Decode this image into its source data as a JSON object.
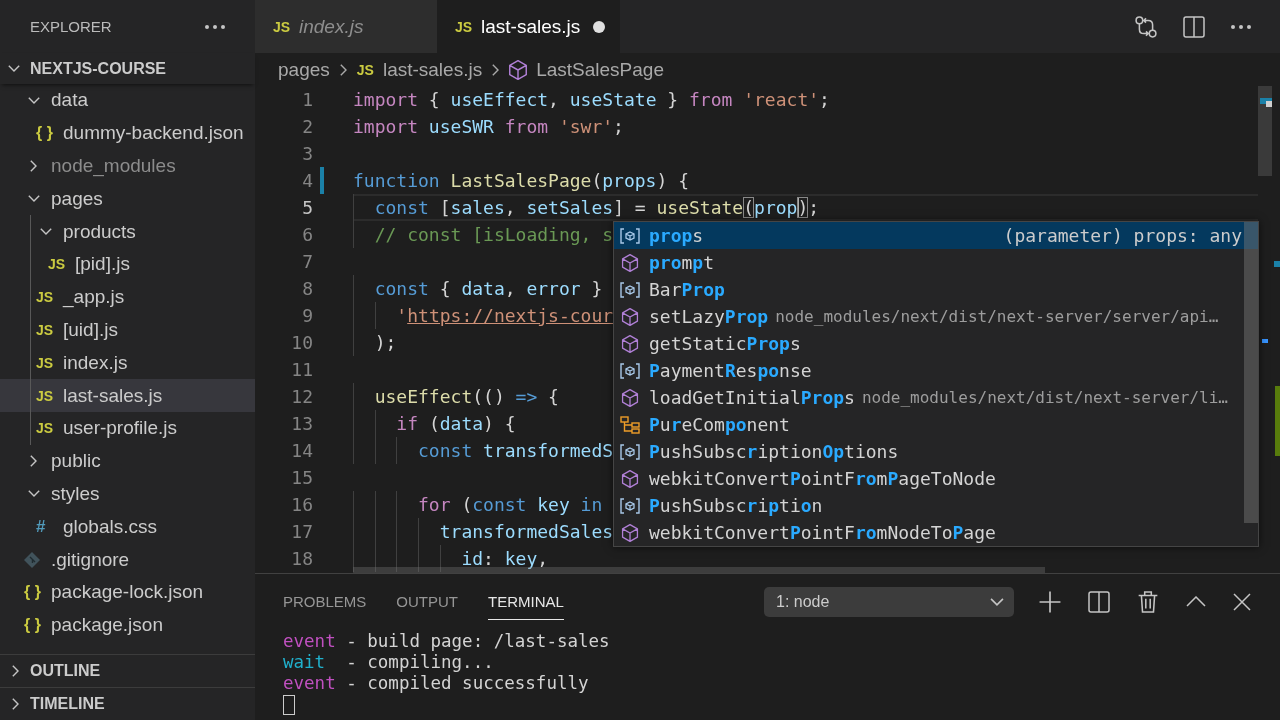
{
  "explorer": {
    "title": "EXPLORER",
    "root": {
      "label": "NEXTJS-COURSE",
      "expanded": true,
      "children": [
        {
          "kind": "folder",
          "label": "data",
          "expanded": true,
          "selected": false,
          "dimmed": false,
          "children": [
            {
              "kind": "json",
              "icon": "{ }",
              "label": "dummy-backend.json",
              "selected": false,
              "dimmed": false
            }
          ]
        },
        {
          "kind": "folder",
          "label": "node_modules",
          "expanded": false,
          "selected": false,
          "dimmed": true
        },
        {
          "kind": "folder",
          "label": "pages",
          "expanded": true,
          "selected": false,
          "dimmed": false,
          "children": [
            {
              "kind": "folder",
              "label": "products",
              "expanded": true,
              "selected": false,
              "dimmed": false,
              "children": [
                {
                  "kind": "js",
                  "icon": "JS",
                  "label": "[pid].js",
                  "selected": false,
                  "dimmed": false
                }
              ]
            },
            {
              "kind": "js",
              "icon": "JS",
              "label": "_app.js",
              "selected": false,
              "dimmed": false
            },
            {
              "kind": "js",
              "icon": "JS",
              "label": "[uid].js",
              "selected": false,
              "dimmed": false
            },
            {
              "kind": "js",
              "icon": "JS",
              "label": "index.js",
              "selected": false,
              "dimmed": false
            },
            {
              "kind": "js",
              "icon": "JS",
              "label": "last-sales.js",
              "selected": true,
              "dimmed": false
            },
            {
              "kind": "js",
              "icon": "JS",
              "label": "user-profile.js",
              "selected": false,
              "dimmed": false
            }
          ]
        },
        {
          "kind": "folder",
          "label": "public",
          "expanded": false,
          "selected": false,
          "dimmed": false
        },
        {
          "kind": "folder",
          "label": "styles",
          "expanded": true,
          "selected": false,
          "dimmed": false,
          "children": [
            {
              "kind": "css",
              "icon": "#",
              "label": "globals.css",
              "selected": false,
              "dimmed": false
            }
          ]
        },
        {
          "kind": "git",
          "label": ".gitignore",
          "selected": false,
          "dimmed": false
        },
        {
          "kind": "json",
          "icon": "{ }",
          "label": "package-lock.json",
          "selected": false,
          "dimmed": false
        },
        {
          "kind": "json",
          "icon": "{ }",
          "label": "package.json",
          "selected": false,
          "dimmed": false
        }
      ]
    },
    "sections": [
      {
        "label": "OUTLINE",
        "expanded": false
      },
      {
        "label": "TIMELINE",
        "expanded": false
      }
    ]
  },
  "tabs": [
    {
      "icon": "JS",
      "label": "index.js",
      "selected": false,
      "preview": true,
      "dirty": false
    },
    {
      "icon": "JS",
      "label": "last-sales.js",
      "selected": true,
      "preview": false,
      "dirty": true
    }
  ],
  "breadcrumbs": [
    {
      "kind": "folder",
      "label": "pages"
    },
    {
      "kind": "file",
      "icon": "JS",
      "label": "last-sales.js"
    },
    {
      "kind": "symbol",
      "label": "LastSalesPage"
    }
  ],
  "editor": {
    "lines": [
      {
        "number": "1",
        "current": false,
        "modified": false,
        "tokens": [
          {
            "kind": "kw",
            "text": "import"
          },
          {
            "kind": "p",
            "text": " { "
          },
          {
            "kind": "var",
            "text": "useEffect"
          },
          {
            "kind": "p",
            "text": ", "
          },
          {
            "kind": "var",
            "text": "useState"
          },
          {
            "kind": "p",
            "text": " } "
          },
          {
            "kind": "kw",
            "text": "from"
          },
          {
            "kind": "str",
            "text": " 'react'"
          },
          {
            "kind": "p",
            "text": ";"
          }
        ]
      },
      {
        "number": "2",
        "current": false,
        "modified": false,
        "tokens": [
          {
            "kind": "kw",
            "text": "import"
          },
          {
            "kind": "var",
            "text": " useSWR"
          },
          {
            "kind": "kw",
            "text": " from"
          },
          {
            "kind": "str",
            "text": " 'swr'"
          },
          {
            "kind": "p",
            "text": ";"
          }
        ]
      },
      {
        "number": "3",
        "current": false,
        "modified": false
      },
      {
        "number": "4",
        "current": false,
        "modified": true,
        "tokens": [
          {
            "kind": "st",
            "text": "function"
          },
          {
            "kind": "fn",
            "text": " LastSalesPage"
          },
          {
            "kind": "p",
            "text": "("
          },
          {
            "kind": "var",
            "text": "props"
          },
          {
            "kind": "p",
            "text": ") {"
          }
        ]
      },
      {
        "number": "5",
        "current": true,
        "modified": false,
        "tokens": [
          {
            "kind": "st",
            "text": "  const"
          },
          {
            "kind": "p",
            "text": " ["
          },
          {
            "kind": "var",
            "text": "sales"
          },
          {
            "kind": "p",
            "text": ", "
          },
          {
            "kind": "var",
            "text": "setSales"
          },
          {
            "kind": "p",
            "text": "] = "
          },
          {
            "kind": "fn",
            "text": "useState"
          },
          {
            "kind": "bm",
            "text": "("
          },
          {
            "kind": "typed",
            "text": "prop"
          },
          {
            "kind": "bm",
            "text": ")"
          },
          {
            "kind": "p",
            "text": ";"
          }
        ]
      },
      {
        "number": "6",
        "current": false,
        "modified": false,
        "tokens": [
          {
            "kind": "cm",
            "text": "  // const [isLoading, s"
          }
        ]
      },
      {
        "number": "7",
        "current": false,
        "modified": false
      },
      {
        "number": "8",
        "current": false,
        "modified": false,
        "tokens": [
          {
            "kind": "st",
            "text": "  const"
          },
          {
            "kind": "p",
            "text": " { "
          },
          {
            "kind": "var",
            "text": "data"
          },
          {
            "kind": "p",
            "text": ", "
          },
          {
            "kind": "var",
            "text": "error"
          },
          {
            "kind": "p",
            "text": " }"
          }
        ]
      },
      {
        "number": "9",
        "current": false,
        "modified": false,
        "tokens": [
          {
            "kind": "str",
            "text": "    '"
          },
          {
            "kind": "link",
            "text": "https://nextjs-cour"
          }
        ]
      },
      {
        "number": "10",
        "current": false,
        "modified": false,
        "tokens": [
          {
            "kind": "p",
            "text": "  );"
          }
        ]
      },
      {
        "number": "11",
        "current": false,
        "modified": false
      },
      {
        "number": "12",
        "current": false,
        "modified": false,
        "tokens": [
          {
            "kind": "fn",
            "text": "  useEffect"
          },
          {
            "kind": "p",
            "text": "(() "
          },
          {
            "kind": "st",
            "text": "=>"
          },
          {
            "kind": "p",
            "text": " {"
          }
        ]
      },
      {
        "number": "13",
        "current": false,
        "modified": false,
        "tokens": [
          {
            "kind": "kw",
            "text": "    if"
          },
          {
            "kind": "p",
            "text": " ("
          },
          {
            "kind": "var",
            "text": "data"
          },
          {
            "kind": "p",
            "text": ") {"
          }
        ]
      },
      {
        "number": "14",
        "current": false,
        "modified": false,
        "tokens": [
          {
            "kind": "st",
            "text": "      const"
          },
          {
            "kind": "var",
            "text": " transformedS"
          }
        ]
      },
      {
        "number": "15",
        "current": false,
        "modified": false
      },
      {
        "number": "16",
        "current": false,
        "modified": false,
        "tokens": [
          {
            "kind": "kw",
            "text": "      for"
          },
          {
            "kind": "p",
            "text": " ("
          },
          {
            "kind": "st",
            "text": "const"
          },
          {
            "kind": "var",
            "text": " key"
          },
          {
            "kind": "st",
            "text": " in"
          }
        ]
      },
      {
        "number": "17",
        "current": false,
        "modified": false,
        "tokens": [
          {
            "kind": "var",
            "text": "        transformedSales"
          }
        ]
      },
      {
        "number": "18",
        "current": false,
        "modified": false,
        "tokens": [
          {
            "kind": "var",
            "text": "          id"
          },
          {
            "kind": "p",
            "text": ": "
          },
          {
            "kind": "var",
            "text": "key"
          },
          {
            "kind": "p",
            "text": ","
          }
        ]
      }
    ],
    "suggestions": [
      {
        "kind": "variable",
        "label": "**prop**s",
        "detail": "(parameter) props: any",
        "selected": true
      },
      {
        "kind": "method",
        "label": "**pro**m**p**t",
        "selected": false
      },
      {
        "kind": "variable",
        "label": "Bar**Prop**",
        "selected": false
      },
      {
        "kind": "method",
        "label": "setLazy**Prop**",
        "detail": "node_modules/next/dist/next-server/server/api…",
        "selected": false
      },
      {
        "kind": "method",
        "label": "getStatic**Prop**s",
        "selected": false
      },
      {
        "kind": "variable",
        "label": "**P**ayment**R**es**po**nse",
        "selected": false
      },
      {
        "kind": "method",
        "label": "loadGetInitial**Prop**s",
        "detail": "node_modules/next/dist/next-server/li…",
        "selected": false
      },
      {
        "kind": "class",
        "label": "**P**u**r**eCom**po**nent",
        "selected": false
      },
      {
        "kind": "variable",
        "label": "**P**ushSubsc**r**iption**Op**tions",
        "selected": false
      },
      {
        "kind": "method",
        "label": "webkitConvert**P**ointF**ro**m**P**ageToNode",
        "selected": false
      },
      {
        "kind": "variable",
        "label": "**P**ushSubsc**r**i**p**ti**o**n",
        "selected": false
      },
      {
        "kind": "method",
        "label": "webkitConvert**P**ointF**ro**mNodeTo**P**age",
        "selected": false
      }
    ]
  },
  "panel": {
    "tabs": [
      {
        "label": "PROBLEMS",
        "selected": false
      },
      {
        "label": "OUTPUT",
        "selected": false
      },
      {
        "label": "TERMINAL",
        "selected": true
      }
    ],
    "terminal_select": "1: node",
    "terminal_lines": [
      {
        "tokens": [
          {
            "kind": "magenta",
            "text": "event"
          },
          {
            "kind": "p",
            "text": " - build page: /last-sales"
          }
        ]
      },
      {
        "tokens": [
          {
            "kind": "cyan",
            "text": "wait"
          },
          {
            "kind": "p",
            "text": "  - compiling..."
          }
        ]
      },
      {
        "tokens": [
          {
            "kind": "magenta",
            "text": "event"
          },
          {
            "kind": "p",
            "text": " - compiled successfully"
          }
        ]
      }
    ]
  }
}
